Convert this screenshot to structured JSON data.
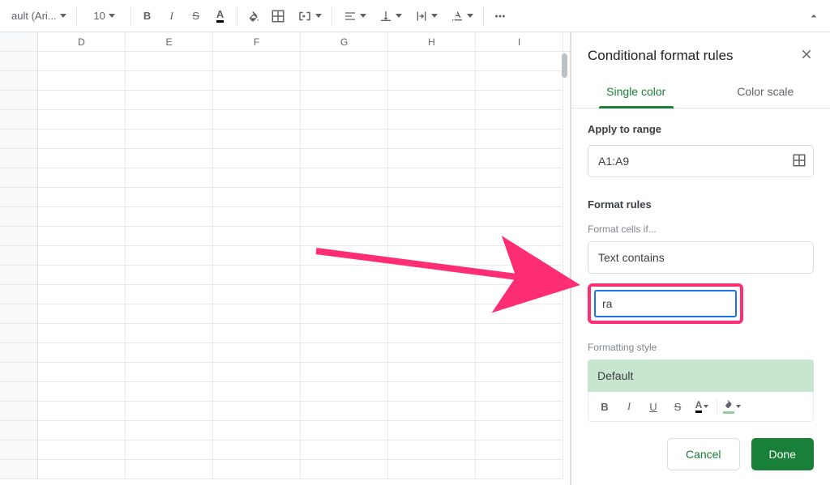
{
  "toolbar": {
    "font_name": "ault (Ari...",
    "font_size": "10"
  },
  "grid": {
    "columns": [
      "D",
      "E",
      "F",
      "G",
      "H",
      "I"
    ]
  },
  "panel": {
    "title": "Conditional format rules",
    "tabs": {
      "single": "Single color",
      "scale": "Color scale"
    },
    "apply_label": "Apply to range",
    "range_value": "A1:A9",
    "rules_label": "Format rules",
    "cells_if_label": "Format cells if...",
    "condition": "Text contains",
    "value": "ra",
    "style_label": "Formatting style",
    "style_name": "Default",
    "cancel": "Cancel",
    "done": "Done"
  }
}
